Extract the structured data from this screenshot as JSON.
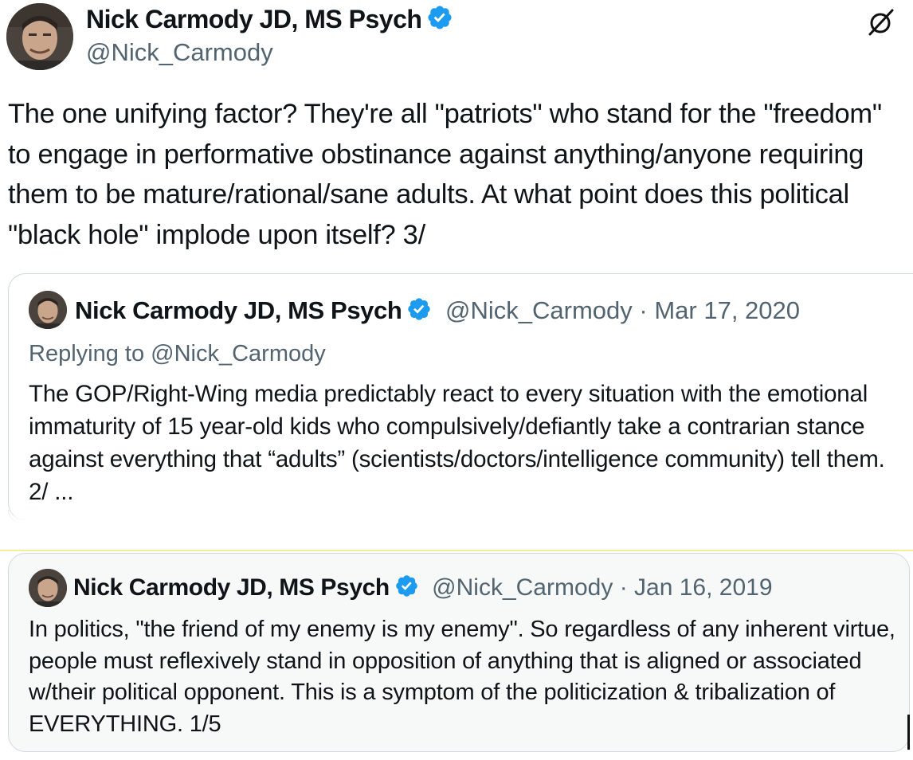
{
  "tweet": {
    "author_name": "Nick Carmody JD, MS Psych",
    "author_handle": "@Nick_Carmody",
    "text": "The one unifying factor? They're all \"patriots\" who stand for the \"freedom\" to engage in performative obstinance against anything/anyone requiring them to be mature/rational/sane adults. At what point does this political \"black hole\" implode upon itself? 3/"
  },
  "quote_1": {
    "author_name": "Nick Carmody JD, MS Psych",
    "author_handle": "@Nick_Carmody",
    "separator": "·",
    "date": "Mar 17, 2020",
    "replying_to": "Replying to @Nick_Carmody",
    "text": "The GOP/Right-Wing media predictably react to every situation with the emotional immaturity of 15 year-old kids who compulsively/defiantly take a contrarian stance against everything that “adults” (scientists/doctors/intelligence community) tell them.  2/ ..."
  },
  "quote_2": {
    "author_name": "Nick Carmody JD, MS Psych",
    "author_handle": "@Nick_Carmody",
    "separator": "·",
    "date": "Jan 16, 2019",
    "text": "In politics, \"the friend of my enemy is my enemy\". So regardless of any inherent virtue, people must reflexively stand in opposition of anything that is aligned or associated w/their political opponent. This is a symptom of the politicization & tribalization of EVERYTHING.  1/5"
  },
  "icons": {
    "verified": "verified-badge-icon",
    "top_right": "x-logo-icon"
  },
  "colors": {
    "verified_blue": "#1d9bf0",
    "secondary_text": "#536471",
    "border": "#cfd9de",
    "quote_bg": "#f7f9f9"
  }
}
